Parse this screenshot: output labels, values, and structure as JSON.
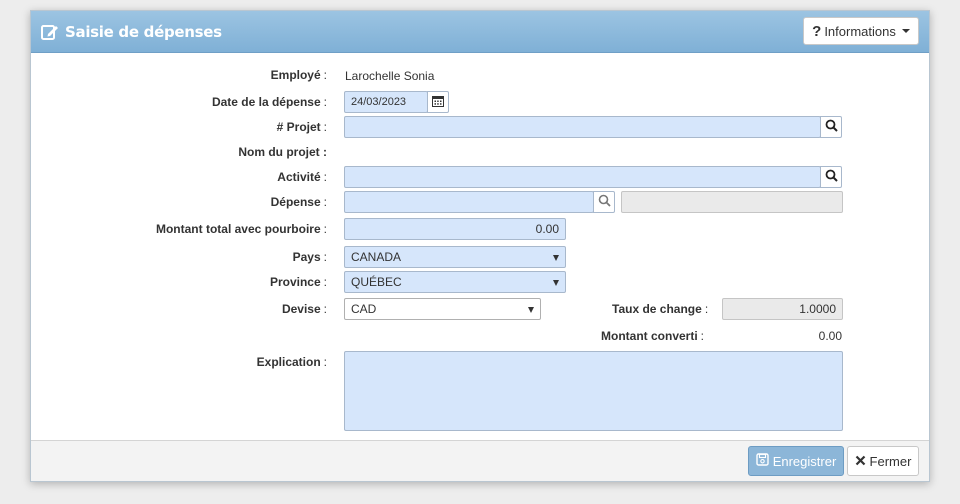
{
  "window": {
    "title": "Saisie de dépenses",
    "info_button": "Informations"
  },
  "form": {
    "employee_label": "Employé",
    "employee_value": "Larochelle Sonia",
    "date_label": "Date de la dépense",
    "date_value": "24/03/2023",
    "project_label": "# Projet",
    "project_value": "",
    "project_name_label": "Nom du projet :",
    "activity_label": "Activité",
    "activity_value": "",
    "expense_label": "Dépense",
    "expense_value": "",
    "expense_desc_value": "",
    "total_label": "Montant total avec pourboire",
    "total_value": "0.00",
    "country_label": "Pays",
    "country_value": "CANADA",
    "province_label": "Province",
    "province_value": "QUÉBEC",
    "currency_label": "Devise",
    "currency_value": "CAD",
    "rate_label": "Taux de change",
    "rate_value": "1.0000",
    "converted_label": "Montant converti",
    "converted_value": "0.00",
    "explanation_label": "Explication",
    "explanation_value": "",
    "colon": ":"
  },
  "footer": {
    "save_label": "Enregistrer",
    "close_label": "Fermer"
  },
  "colors": {
    "titlebar": "#8ab9dc",
    "field_bg": "#d6e6fb",
    "save_button": "#8cb6d8"
  }
}
